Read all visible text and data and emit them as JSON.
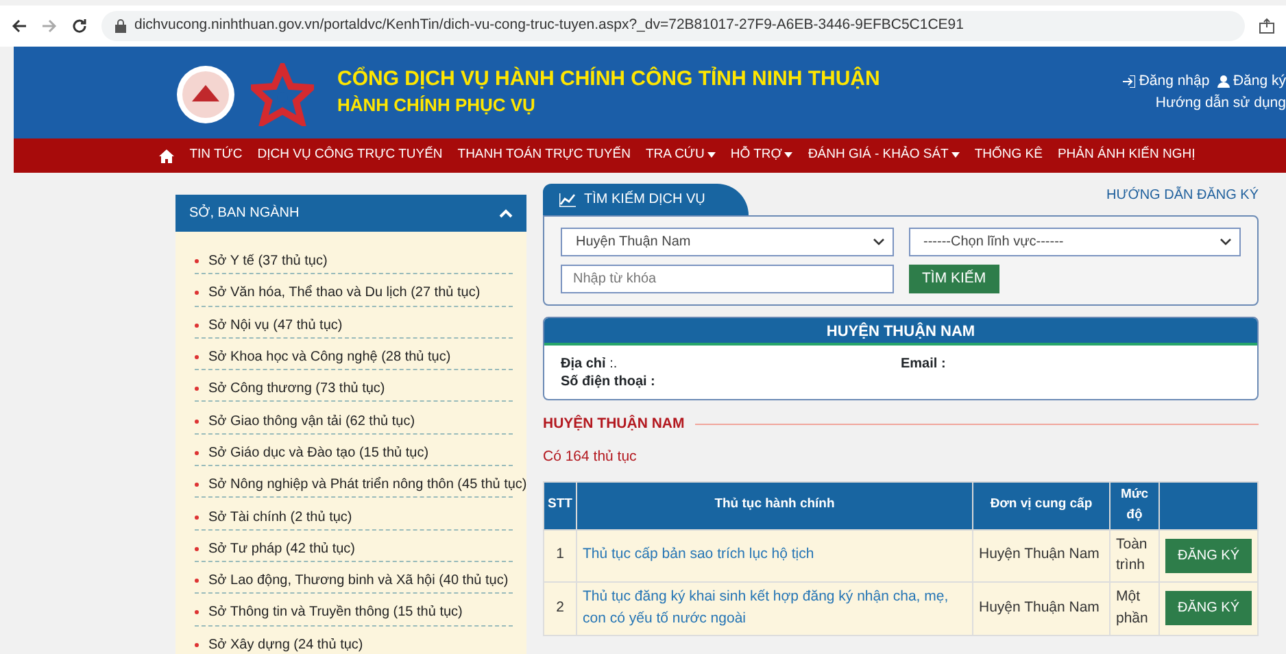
{
  "browser": {
    "url": "dichvucong.ninhthuan.gov.vn/portaldvc/KenhTin/dich-vu-cong-truc-tuyen.aspx?_dv=72B81017-27F9-A6EB-3446-9EFBC5C1CE91"
  },
  "header": {
    "title": "CỔNG DỊCH VỤ HÀNH CHÍNH CÔNG TỈNH NINH THUẬN",
    "subtitle": "HÀNH CHÍNH PHỤC VỤ",
    "login": "Đăng nhập",
    "register": "Đăng ký",
    "guide": "Hướng dẫn sử dụng"
  },
  "nav": [
    {
      "label": "TIN TỨC",
      "dropdown": false
    },
    {
      "label": "DỊCH VỤ CÔNG TRỰC TUYẾN",
      "dropdown": false
    },
    {
      "label": "THANH TOÁN TRỰC TUYẾN",
      "dropdown": false
    },
    {
      "label": "TRA CỨU",
      "dropdown": true
    },
    {
      "label": "HỖ TRỢ",
      "dropdown": true
    },
    {
      "label": "ĐÁNH GIÁ - KHẢO SÁT",
      "dropdown": true
    },
    {
      "label": "THỐNG KÊ",
      "dropdown": false
    },
    {
      "label": "PHẢN ÁNH KIẾN NGHỊ",
      "dropdown": false
    }
  ],
  "sidebar": {
    "title": "SỞ, BAN NGÀNH",
    "items": [
      "Sở Y tế (37 thủ tục)",
      "Sở Văn hóa, Thể thao và Du lịch (27 thủ tục)",
      "Sở Nội vụ (47 thủ tục)",
      "Sở Khoa học và Công nghệ (28 thủ tục)",
      "Sở Công thương (73 thủ tục)",
      "Sở Giao thông vận tải (62 thủ tục)",
      "Sở Giáo dục và Đào tạo (15 thủ tục)",
      "Sở Nông nghiệp và Phát triển nông thôn (45 thủ tục)",
      "Sở Tài chính (2 thủ tục)",
      "Sở Tư pháp (42 thủ tục)",
      "Sở Lao động, Thương binh và Xã hội (40 thủ tục)",
      "Sở Thông tin và Truyền thông (15 thủ tục)",
      "Sở Xây dựng (24 thủ tục)"
    ]
  },
  "search": {
    "tab": "TÌM KIẾM DỊCH VỤ",
    "guide_link": "HƯỚNG DẪN ĐĂNG KÝ",
    "unit_select": "Huyện Thuận Nam",
    "field_select": "------Chọn lĩnh vực------",
    "keyword_placeholder": "Nhập từ khóa",
    "button": "TÌM KIẾM"
  },
  "unit_info": {
    "title": "HUYỆN THUẬN NAM",
    "address_label": "Địa chỉ",
    "address_value": ":.",
    "email_label": "Email :",
    "phone_label": "Số điện thoại :"
  },
  "results": {
    "heading": "HUYỆN THUẬN NAM",
    "count": "Có 164 thủ tục",
    "table": {
      "columns": [
        "STT",
        "Thủ tục hành chính",
        "Đơn vị cung cấp",
        "Mức độ"
      ],
      "rows": [
        {
          "stt": "1",
          "procedure": "Thủ tục cấp bản sao trích lục hộ tịch",
          "unit": "Huyện Thuận Nam",
          "level": "Toàn trình",
          "action": "ĐĂNG KÝ"
        },
        {
          "stt": "2",
          "procedure": "Thủ tục đăng ký khai sinh kết hợp đăng ký nhận cha, mẹ, con có yếu tố nước ngoài",
          "unit": "Huyện Thuận Nam",
          "level": "Một phần",
          "action": "ĐĂNG KÝ"
        }
      ]
    }
  }
}
